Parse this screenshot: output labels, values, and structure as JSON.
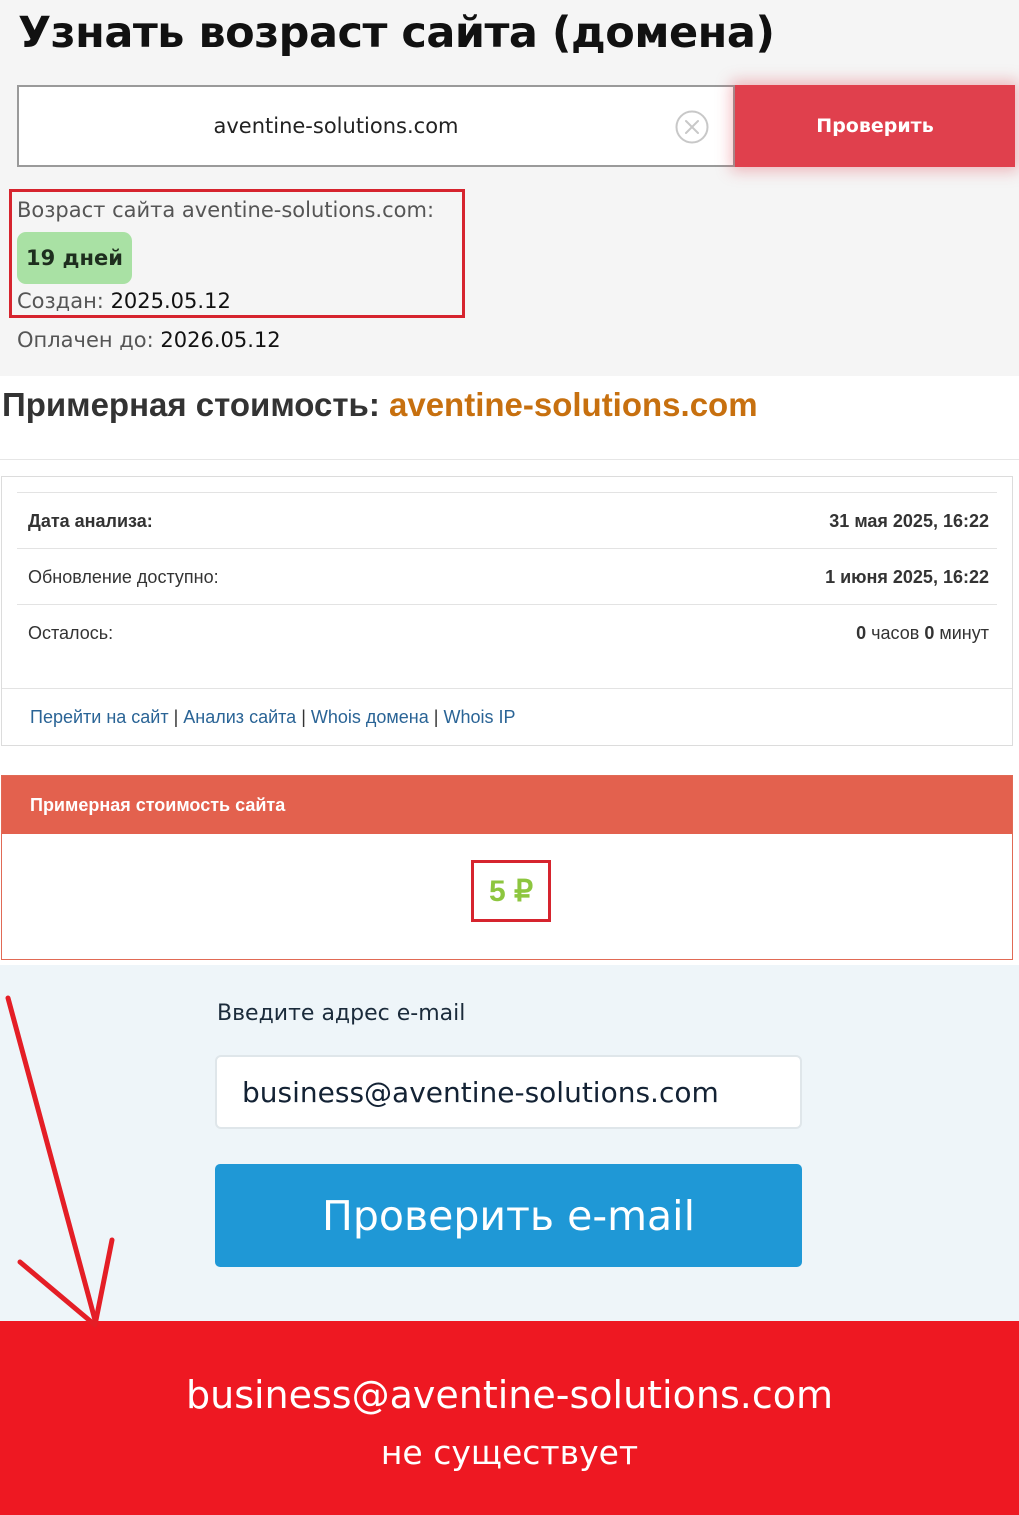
{
  "age_checker": {
    "title": "Узнать возраст сайта (домена)",
    "domain_value": "aventine-solutions.com",
    "check_label": "Проверить",
    "age_label": "Возраст сайта aventine-solutions.com:",
    "age_value": "19 дней",
    "created_label": "Создан:",
    "created_value": "2025.05.12",
    "paid_label": "Оплачен до:",
    "paid_value": "2026.05.12"
  },
  "cost": {
    "title_prefix": "Примерная стоимость:",
    "title_domain": "aventine-solutions.com",
    "rows": [
      {
        "label": "Дата анализа:",
        "value": "31 мая 2025, 16:22"
      },
      {
        "label": "Обновление доступно:",
        "value": "1 июня 2025, 16:22"
      }
    ],
    "remaining": {
      "label": "Осталось:",
      "hours": "0",
      "hours_unit": "часов",
      "minutes": "0",
      "minutes_unit": "минут"
    },
    "links": [
      "Перейти на сайт",
      "Анализ сайта",
      "Whois домена",
      "Whois IP"
    ],
    "price_header": "Примерная стоимость сайта",
    "price_value": "5 ₽"
  },
  "email_check": {
    "label": "Введите адрес e-mail",
    "email_value": "business@aventine-solutions.com",
    "button_label": "Проверить e-mail",
    "result_email": "business@aventine-solutions.com",
    "result_status": "не существует"
  },
  "colors": {
    "check_button": "#e0404d",
    "age_badge": "#a9e1a4",
    "highlight_red": "#d6242e",
    "domain_orange": "#c7700f",
    "price_header": "#e3614e",
    "price_green": "#8dc63f",
    "email_button": "#1f98d6",
    "result_banner": "#ee1822"
  }
}
